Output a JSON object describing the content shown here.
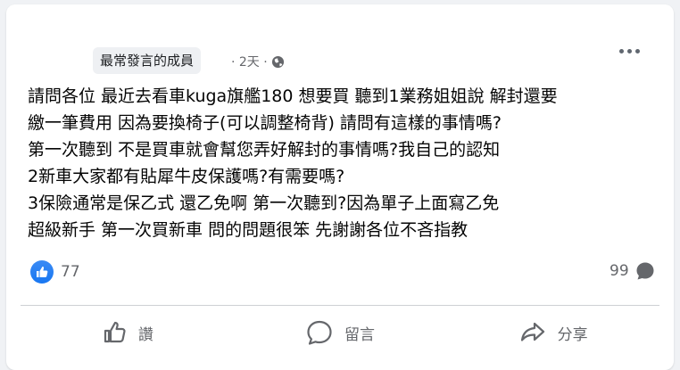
{
  "post": {
    "author_badge": "最常發言的成員",
    "timestamp": "· 2天 ·",
    "body_lines": [
      "請問各位 最近去看車kuga旗艦180 想要買 聽到1業務姐姐說 解封還要",
      "繳一筆費用 因為要換椅子(可以調整椅背) 請問有這樣的事情嗎?",
      "第一次聽到 不是買車就會幫您弄好解封的事情嗎?我自己的認知",
      "2新車大家都有貼犀牛皮保護嗎?有需要嗎?",
      "3保險通常是保乙式 還乙免啊 第一次聽到?因為單子上面寫乙免",
      "超級新手 第一次買新車 問的問題很笨 先謝謝各位不吝指教"
    ]
  },
  "stats": {
    "reaction_count": "77",
    "comment_count": "99"
  },
  "actions": {
    "like_label": "讚",
    "comment_label": "留言",
    "share_label": "分享"
  },
  "colors": {
    "like_blue": "#1877f2",
    "secondary_text": "#65676b"
  }
}
